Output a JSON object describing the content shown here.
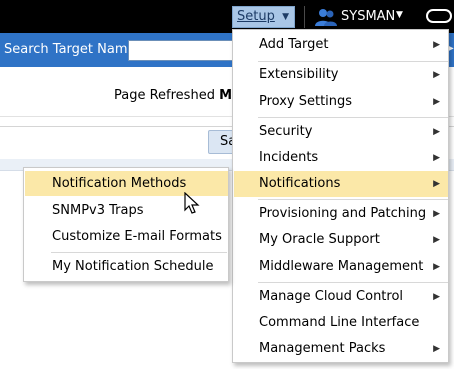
{
  "header": {
    "setup_label": "Setup",
    "user_name": "SYSMAN"
  },
  "search": {
    "label": "Search Target Name"
  },
  "page": {
    "refresh_prefix": "Page Refreshed",
    "refresh_value": "Ma",
    "search_button": "Sa"
  },
  "setup_menu": {
    "items": [
      {
        "label": "Add Target",
        "submenu": true
      },
      {
        "label": "Extensibility",
        "submenu": true
      },
      {
        "label": "Proxy Settings",
        "submenu": true
      },
      {
        "label": "Security",
        "submenu": true
      },
      {
        "label": "Incidents",
        "submenu": true
      },
      {
        "label": "Notifications",
        "submenu": true,
        "highlighted": true
      },
      {
        "label": "Provisioning and Patching",
        "submenu": true
      },
      {
        "label": "My Oracle Support",
        "submenu": true
      },
      {
        "label": "Middleware Management",
        "submenu": true
      },
      {
        "label": "Manage Cloud Control",
        "submenu": true
      },
      {
        "label": "Command Line Interface",
        "submenu": false
      },
      {
        "label": "Management Packs",
        "submenu": true
      }
    ]
  },
  "notifications_submenu": {
    "items": [
      {
        "label": "Notification Methods",
        "highlighted": true
      },
      {
        "label": "SNMPv3 Traps"
      },
      {
        "label": "Customize E-mail Formats"
      },
      {
        "label": "My Notification Schedule"
      }
    ]
  },
  "colors": {
    "topbar": "#000000",
    "searchbar": "#2f73c6",
    "highlight": "#fbe8a8",
    "setup_button": "#a9c6e6"
  }
}
